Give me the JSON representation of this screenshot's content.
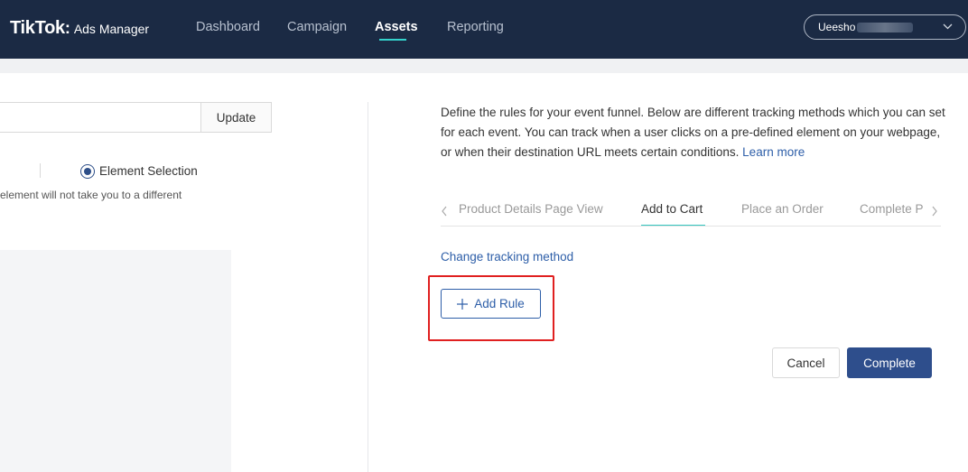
{
  "header": {
    "logo_brand": "TikTok",
    "logo_colon": ":",
    "logo_product": "Ads Manager",
    "nav": [
      {
        "label": "Dashboard",
        "active": false
      },
      {
        "label": "Campaign",
        "active": false
      },
      {
        "label": "Assets",
        "active": true
      },
      {
        "label": "Reporting",
        "active": false
      }
    ],
    "account_label": "Ueesho",
    "account_chevron": "chevron-down-icon"
  },
  "left_panel": {
    "url_value": "",
    "update_label": "Update",
    "radio_label": "Element Selection",
    "hint_text": "element will not take you to a different"
  },
  "right_panel": {
    "description": "Define the rules for your event funnel. Below are different tracking methods which you can set for each event. You can track when a user clicks on a pre-defined element on your webpage, or when their destination URL meets certain conditions.",
    "learn_more": "Learn more",
    "tabs": [
      {
        "label": "Product Details Page View",
        "active": false
      },
      {
        "label": "Add to Cart",
        "active": true
      },
      {
        "label": "Place an Order",
        "active": false
      },
      {
        "label": "Complete P",
        "active": false
      }
    ],
    "tab_prev_icon": "chevron-left-icon",
    "tab_next_icon": "chevron-right-icon",
    "change_tracking_label": "Change tracking method",
    "add_rule_label": "Add Rule",
    "cancel_label": "Cancel",
    "complete_label": "Complete"
  },
  "colors": {
    "nav_bg": "#1b2a44",
    "accent_teal": "#34d2cc",
    "primary_blue": "#2e4e8c",
    "link_blue": "#2d5ea8",
    "highlight_red": "#e02020"
  }
}
